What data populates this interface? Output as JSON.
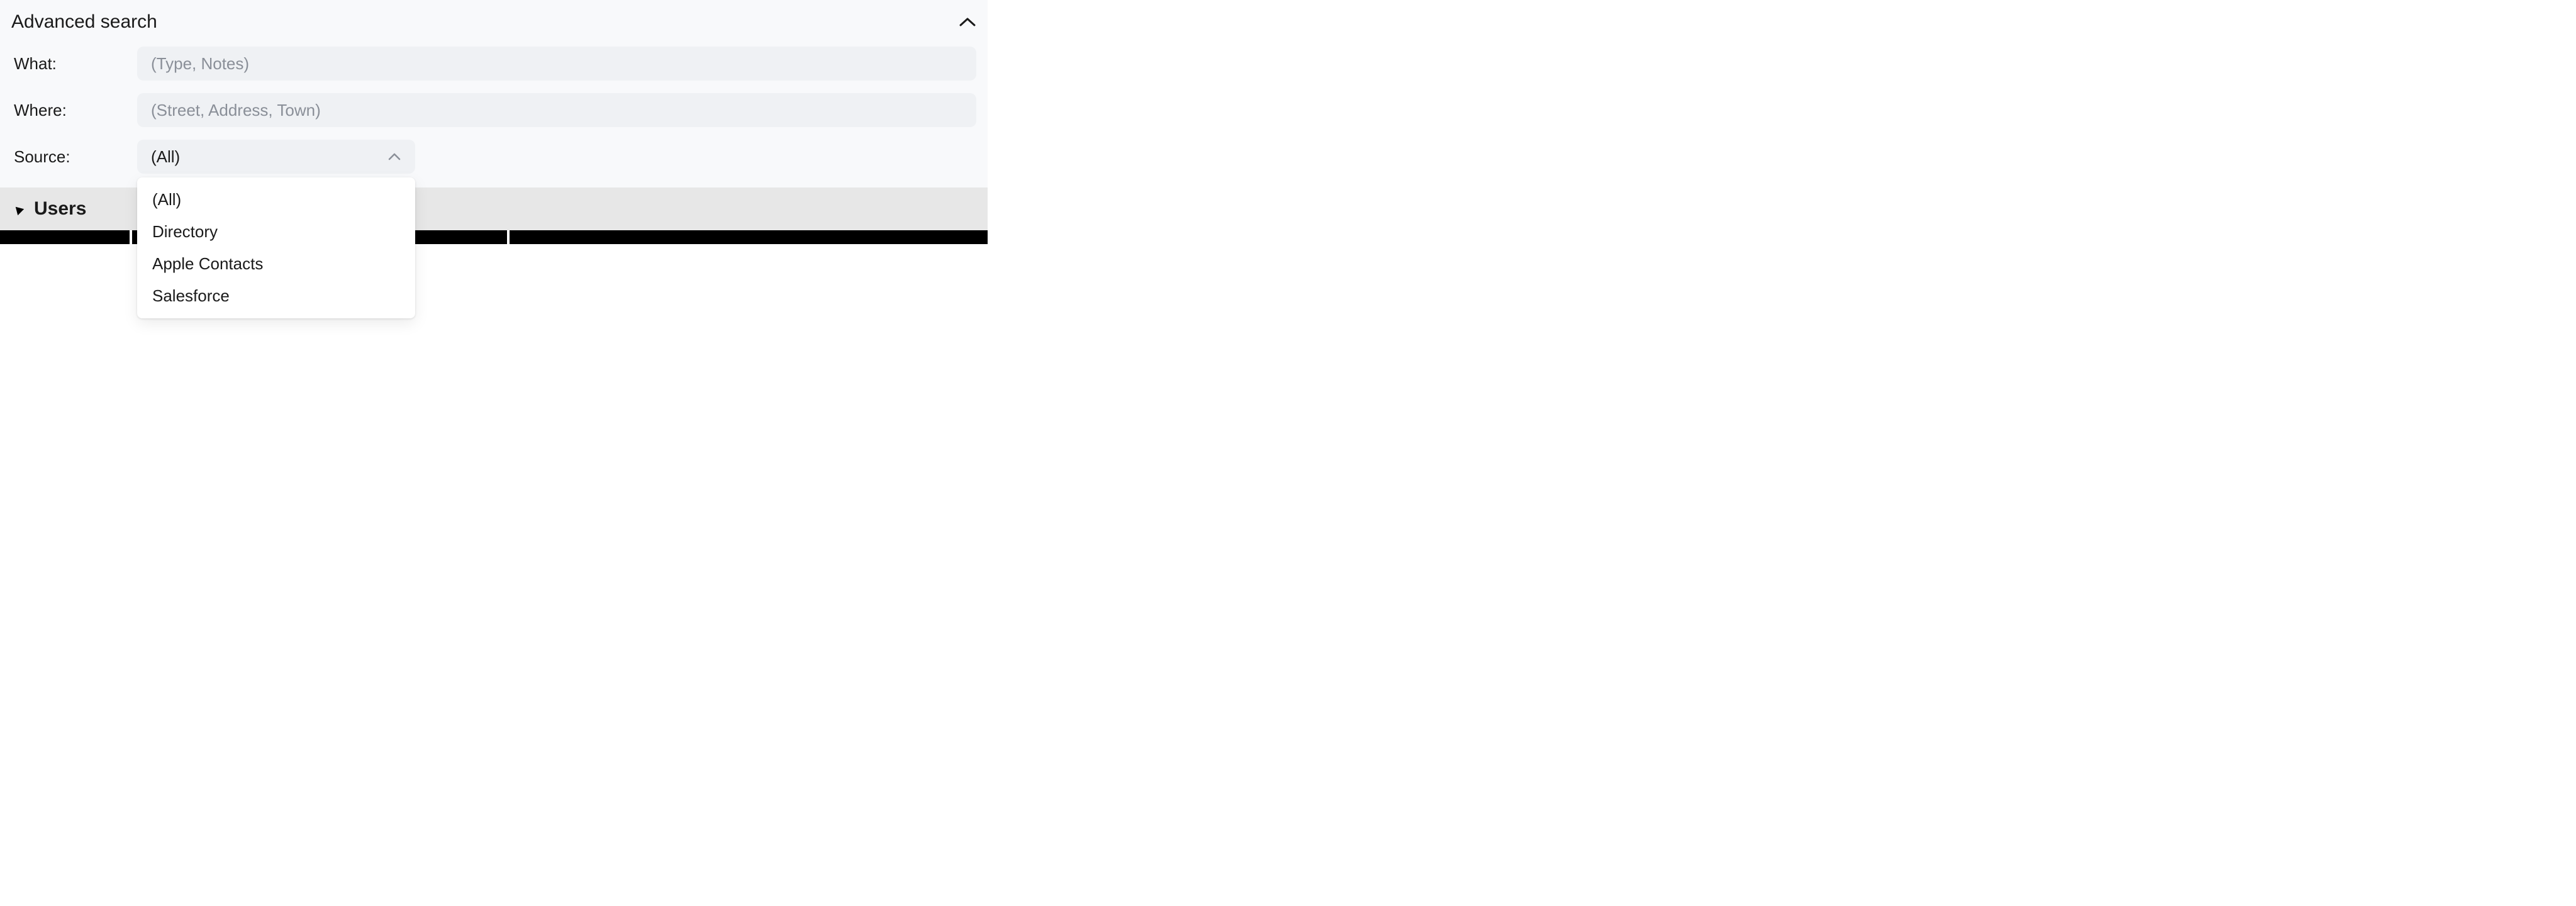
{
  "panel": {
    "title": "Advanced search"
  },
  "form": {
    "what": {
      "label": "What:",
      "placeholder": "(Type, Notes)",
      "value": ""
    },
    "where": {
      "label": "Where:",
      "placeholder": "(Street, Address, Town)",
      "value": ""
    },
    "source": {
      "label": "Source:",
      "selected": "(All)",
      "options": [
        "(All)",
        "Directory",
        "Apple Contacts",
        "Salesforce"
      ]
    }
  },
  "group": {
    "title": "Users"
  }
}
